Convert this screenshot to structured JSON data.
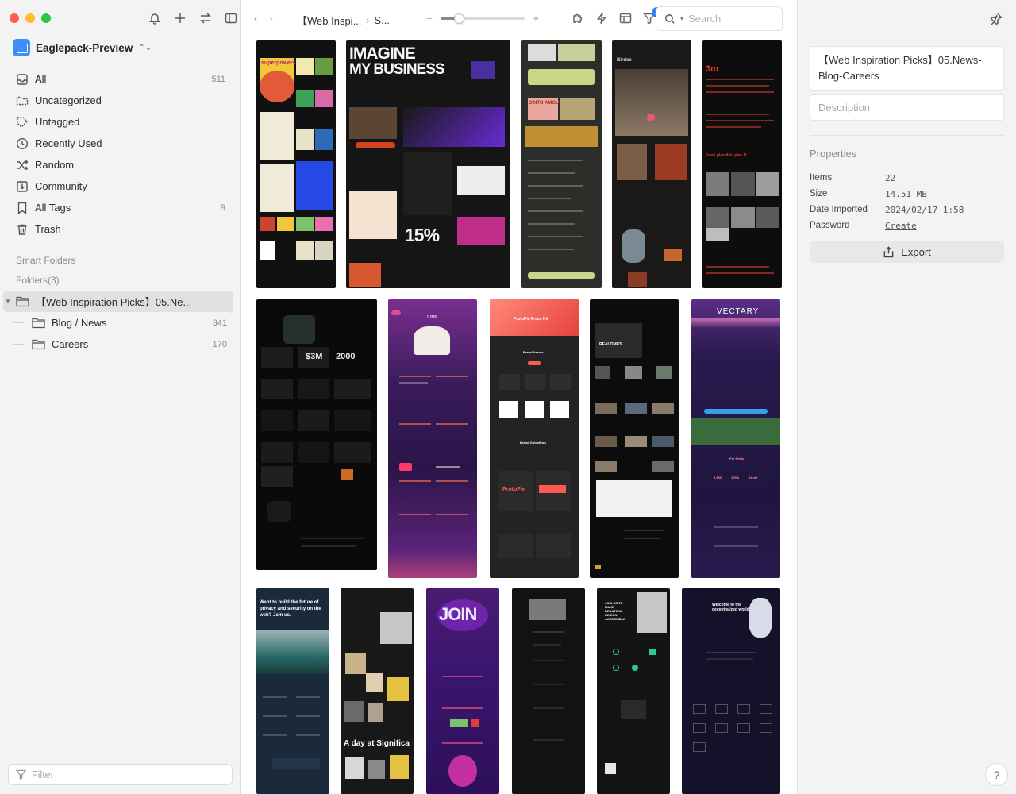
{
  "window": {
    "traffic_lights": {
      "close": "#ff5f57",
      "minimize": "#febc2e",
      "zoom": "#28c840"
    }
  },
  "sidebar": {
    "library_name": "Eaglepack-Preview",
    "library_chevron": "⌃⌄",
    "nav_items": [
      {
        "label": "All",
        "count": "511",
        "icon": "inbox-icon"
      },
      {
        "label": "Uncategorized",
        "count": "",
        "icon": "folder-outline-icon"
      },
      {
        "label": "Untagged",
        "count": "",
        "icon": "tag-outline-icon"
      },
      {
        "label": "Recently Used",
        "count": "",
        "icon": "clock-icon"
      },
      {
        "label": "Random",
        "count": "",
        "icon": "shuffle-icon"
      },
      {
        "label": "Community",
        "count": "",
        "icon": "download-box-icon"
      },
      {
        "label": "All Tags",
        "count": "9",
        "icon": "bookmark-icon"
      },
      {
        "label": "Trash",
        "count": "",
        "icon": "trash-icon"
      }
    ],
    "smart_folders_label": "Smart Folders",
    "folders_label": "Folders(3)",
    "folders": [
      {
        "label": "【Web Inspiration Picks】05.Ne...",
        "count": "",
        "selected": true
      },
      {
        "label": "Blog / News",
        "count": "341",
        "selected": false
      },
      {
        "label": "Careers",
        "count": "170",
        "selected": false
      }
    ],
    "filter_placeholder": "Filter"
  },
  "toolbar": {
    "back": "‹",
    "forward": "›",
    "breadcrumb": [
      "【Web Inspi...",
      "S..."
    ],
    "breadcrumb_sep": "›",
    "zoom_minus": "−",
    "zoom_plus": "+",
    "zoom_level": 0.22,
    "filter_badge": "1",
    "search_placeholder": "Search"
  },
  "inspector": {
    "title": "【Web Inspiration Picks】05.News-Blog-Careers",
    "description_placeholder": "Description",
    "properties_label": "Properties",
    "properties": [
      {
        "key": "Items",
        "value": "22",
        "link": false
      },
      {
        "key": "Size",
        "value": "14.51 MB",
        "link": false
      },
      {
        "key": "Date Imported",
        "value": "2024/02/17 1:58",
        "link": false
      },
      {
        "key": "Password",
        "value": "Create",
        "link": true
      }
    ],
    "export_label": "Export",
    "help_label": "?"
  },
  "thumbnails": {
    "row1": [
      {
        "name": "thumb-illustrated-site",
        "bg": "#111111",
        "texts": [
          "superpowers",
          "Transforming the impact of human generosity"
        ]
      },
      {
        "name": "thumb-imagine-my-business",
        "bg": "#151515",
        "texts": [
          "IMAGINE",
          "MY BUSINESS",
          "15%"
        ]
      },
      {
        "name": "thumb-green-dashboard",
        "bg": "#2c2e2a",
        "texts": [
          "DINTO AMOUNT"
        ]
      },
      {
        "name": "thumb-birdee",
        "bg": "#1a1918",
        "texts": [
          "Birdee"
        ]
      },
      {
        "name": "thumb-red-text-site",
        "bg": "#0d0d0d",
        "texts": [
          "3m",
          "From plan A to plan B"
        ]
      }
    ],
    "row2": [
      {
        "name": "thumb-dark-3d-cards",
        "bg": "#0a0a0a",
        "texts": [
          "$3M",
          "2000"
        ]
      },
      {
        "name": "thumb-purple-jump",
        "bg": "#3a1c5c",
        "texts": [
          "JUMP"
        ]
      },
      {
        "name": "thumb-protopie",
        "bg": "#232323",
        "texts": [
          "ProtoPie Press Kit",
          "Brand Assets",
          "Brand Guidelines",
          "ProtoPie"
        ]
      },
      {
        "name": "thumb-realtimes",
        "bg": "#0c0c0c",
        "texts": [
          "REALTIMES"
        ]
      },
      {
        "name": "thumb-vectary",
        "bg": "#2a1b4e",
        "texts": [
          "VECTARY",
          "For fields",
          "3,980",
          "125 k",
          "34 m2"
        ]
      }
    ],
    "row3": [
      {
        "name": "thumb-privacy-security",
        "bg": "#1b2a3a",
        "texts": [
          "Want to build the future of privacy and security on the web? Join us."
        ]
      },
      {
        "name": "thumb-significa",
        "bg": "#181818",
        "texts": [
          "A day at Significa"
        ]
      },
      {
        "name": "thumb-join-purple",
        "bg": "#3b1670",
        "texts": [
          "JOIN"
        ]
      },
      {
        "name": "thumb-dark-article",
        "bg": "#121212",
        "texts": []
      },
      {
        "name": "thumb-join-us-make",
        "bg": "#141414",
        "texts": [
          "JOIN US TO MAKE BEAUTIFUL DESIGN ACCESSIBLE"
        ]
      },
      {
        "name": "thumb-decentralized-world",
        "bg": "#14122a",
        "texts": [
          "Welcome to the decentralized world"
        ]
      }
    ]
  }
}
